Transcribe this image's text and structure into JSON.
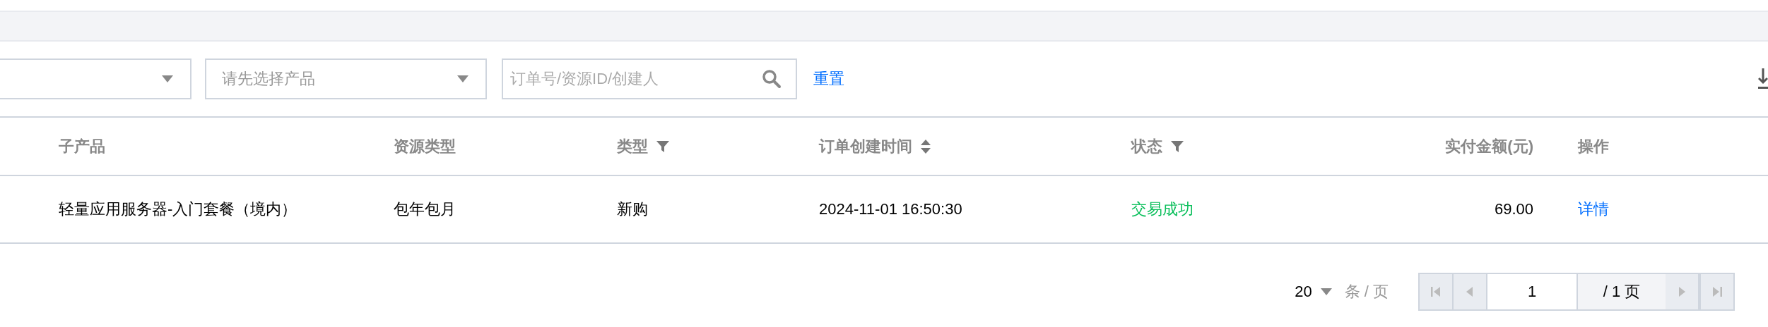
{
  "filters": [
    {
      "kind": "select"
    },
    {
      "kind": "select",
      "placeholder": "请先选择产品"
    },
    {
      "kind": "search",
      "placeholder": "订单号/资源ID/创建人"
    }
  ],
  "reset_link": "重置",
  "table": {
    "columns": [
      {
        "label": "子产品",
        "kind": "text"
      },
      {
        "label": "资源类型",
        "kind": "text"
      },
      {
        "label": "类型",
        "kind": "text",
        "filterable": true
      },
      {
        "label": "订单创建时间",
        "kind": "text",
        "sortable": true
      },
      {
        "label": "状态",
        "kind": "status",
        "filterable": true
      },
      {
        "label": "实付金额(元)",
        "kind": "amount"
      },
      {
        "label": "操作",
        "kind": "action"
      }
    ],
    "rows": [
      [
        "轻量应用服务器-入门套餐（境内）",
        "包年包月",
        "新购",
        "2024-11-01 16:50:30",
        "交易成功",
        "69.00",
        "详情"
      ]
    ]
  },
  "pagination": {
    "page_size": "20",
    "page_size_unit": "条 / 页",
    "page": "1",
    "total_pages": "/ 1 页",
    "buttons": [
      {
        "kind": "first",
        "disabled": true
      },
      {
        "kind": "prev",
        "disabled": true
      },
      {
        "kind": "next",
        "disabled": true
      },
      {
        "kind": "last",
        "disabled": true
      }
    ]
  }
}
